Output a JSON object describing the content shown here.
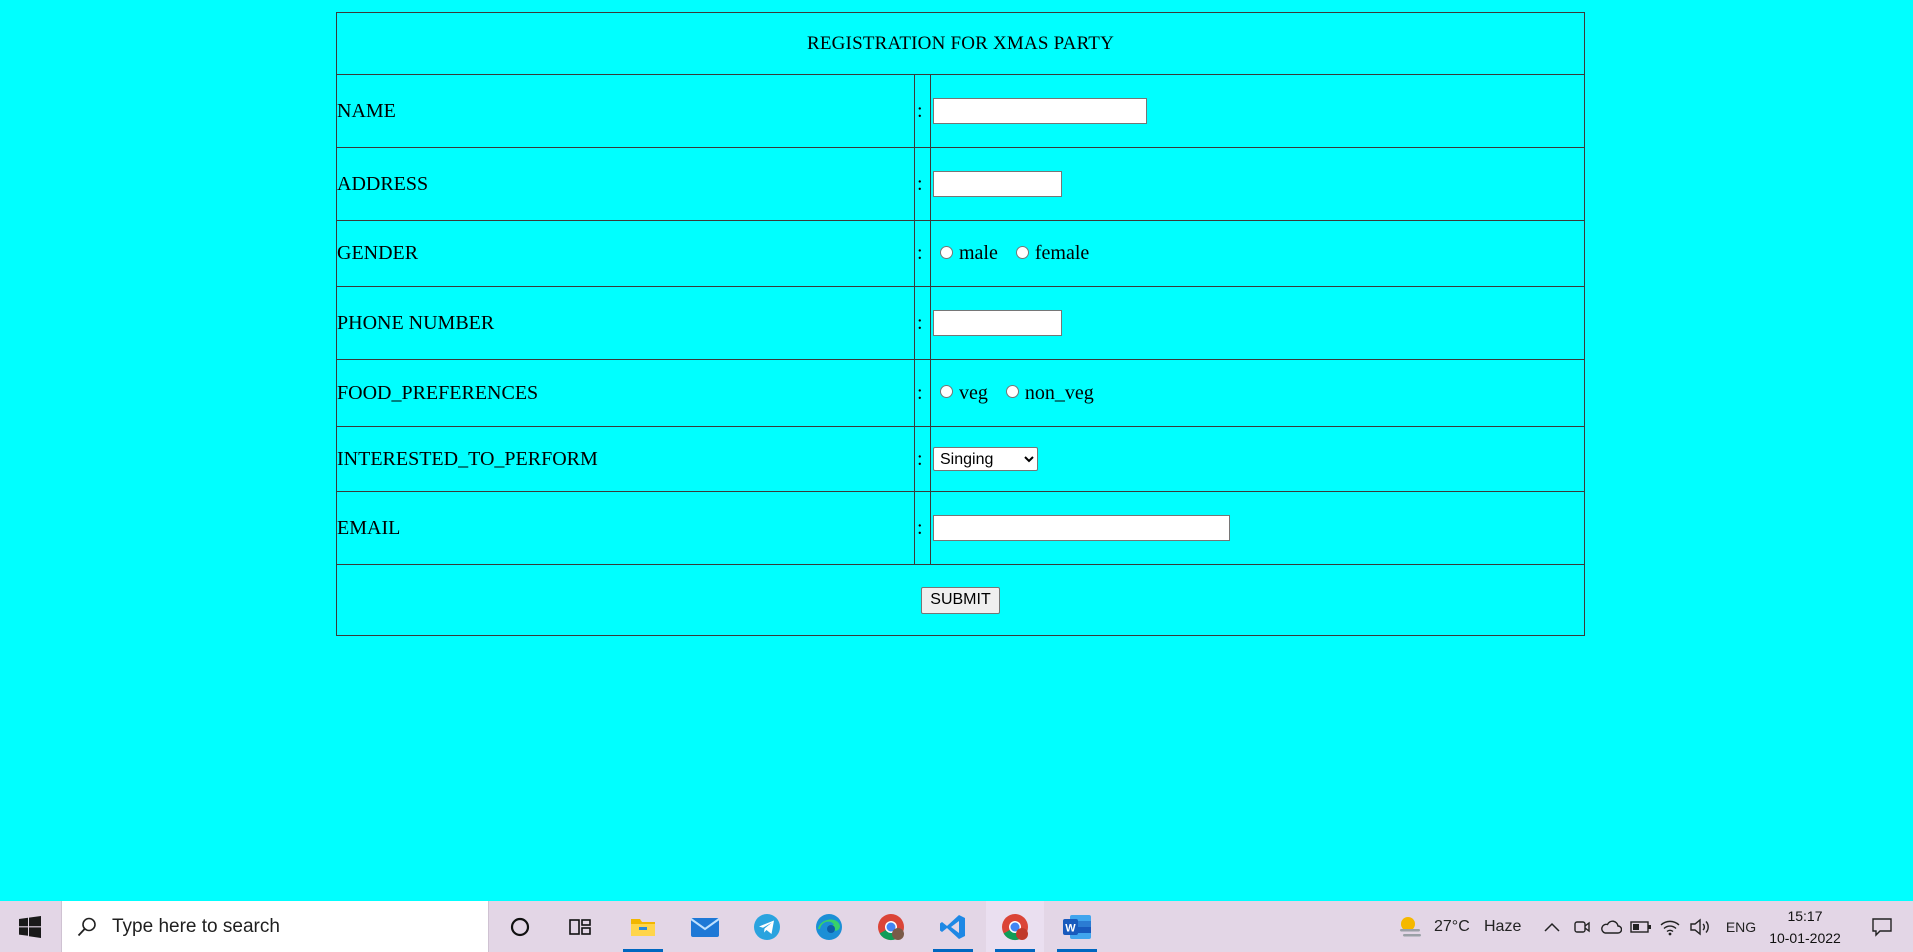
{
  "form": {
    "title": "REGISTRATION FOR XMAS PARTY",
    "colon": ":",
    "fields": {
      "name": {
        "label": "NAME",
        "value": ""
      },
      "address": {
        "label": "ADDRESS",
        "value": ""
      },
      "gender": {
        "label": "GENDER",
        "options": [
          "male",
          "female"
        ]
      },
      "phone": {
        "label": "PHONE NUMBER",
        "value": ""
      },
      "food": {
        "label": "FOOD_PREFERENCES",
        "options": [
          "veg",
          "non_veg"
        ]
      },
      "perform": {
        "label": "INTERESTED_TO_PERFORM",
        "selected": "Singing"
      },
      "email": {
        "label": "EMAIL",
        "value": ""
      }
    },
    "submit_label": "SUBMIT"
  },
  "taskbar": {
    "search_placeholder": "Type here to search",
    "apps": [
      "cortana-icon",
      "task-view-icon",
      "file-explorer-icon",
      "mail-icon",
      "telegram-icon",
      "edge-icon",
      "chrome-icon",
      "vscode-icon",
      "chrome-profile-icon",
      "word-icon"
    ],
    "weather": {
      "temp": "27°C",
      "condition": "Haze"
    },
    "language": "ENG",
    "time": "15:17",
    "date": "10-01-2022"
  },
  "colors": {
    "page_bg": "#00ffff",
    "border": "#3a3a3a",
    "taskbar_bg": "#e3d6e6",
    "accent": "#0067c0"
  }
}
